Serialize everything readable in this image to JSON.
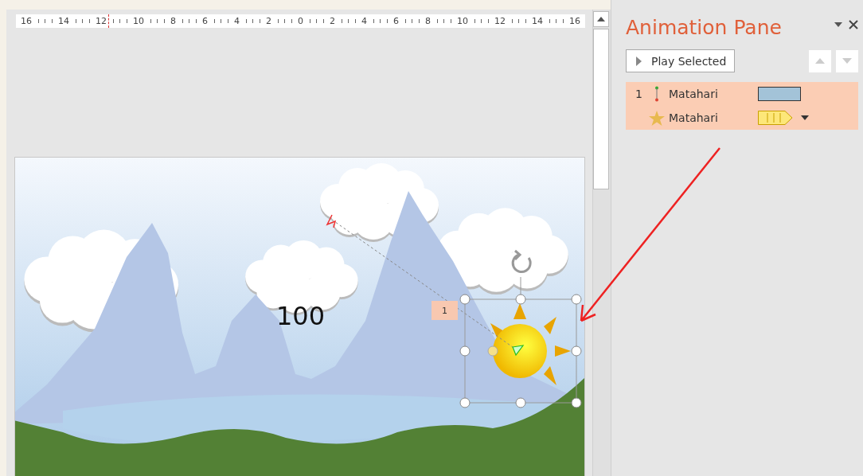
{
  "ruler": {
    "labels": [
      "16",
      "14",
      "12",
      "10",
      "8",
      "6",
      "4",
      "2",
      "0",
      "2",
      "4",
      "6",
      "8",
      "10",
      "12",
      "14",
      "16"
    ]
  },
  "slide": {
    "text": "100",
    "animation_tag": "1"
  },
  "animation_pane": {
    "title": "Animation Pane",
    "play_button": "Play Selected",
    "items": [
      {
        "kind": "motion",
        "number": "1",
        "name": "Matahari",
        "selected": true
      },
      {
        "kind": "emphasis",
        "name": "Matahari",
        "selected": true
      }
    ]
  }
}
